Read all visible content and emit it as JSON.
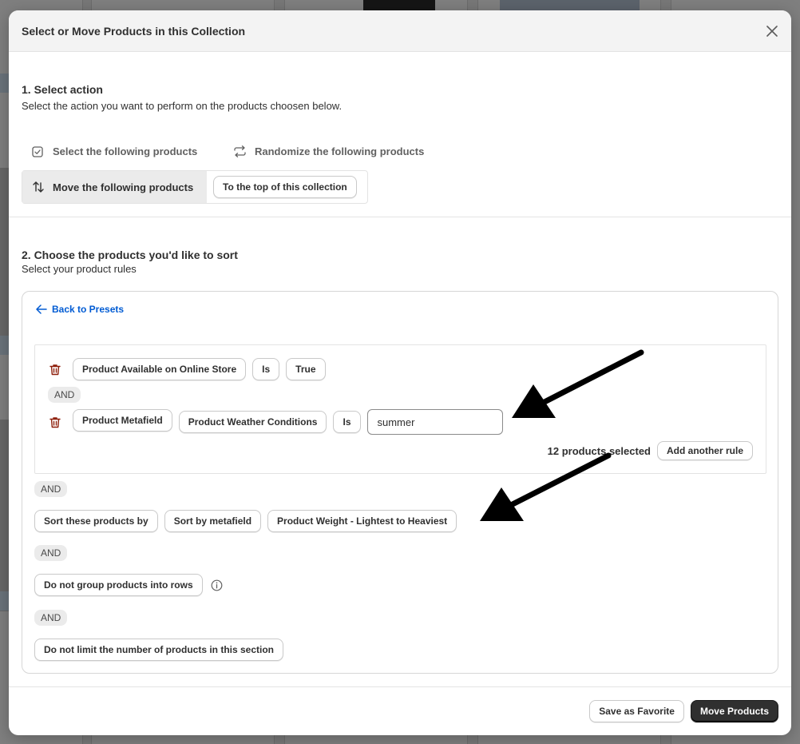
{
  "modal": {
    "title": "Select or Move Products in this Collection",
    "close_icon": "close-icon"
  },
  "step1": {
    "title": "1. Select action",
    "subtitle": "Select the action you want to perform on the products choosen below.",
    "options": {
      "select_label": "Select the following products",
      "randomize_label": "Randomize the following products",
      "move_label": "Move the following products",
      "move_target": "To the top of this collection"
    }
  },
  "step2": {
    "title": "2. Choose the products you'd like to sort",
    "subtitle": "Select your product rules",
    "back_link": "Back to Presets",
    "rules": [
      {
        "field": "Product Available on Online Store",
        "operator": "Is",
        "value": "True"
      },
      {
        "field": "Product Metafield",
        "subfield": "Product Weather Conditions",
        "operator": "Is",
        "value": "summer"
      }
    ],
    "and_label": "AND",
    "selected_count": "12 products selected",
    "add_rule": "Add another rule",
    "sort": {
      "label": "Sort these products by",
      "type": "Sort by metafield",
      "order": "Product Weight - Lightest to Heaviest"
    },
    "group_label": "Do not group products into rows",
    "limit_label": "Do not limit the number of products in this section"
  },
  "footer": {
    "save_favorite": "Save as Favorite",
    "move_products": "Move Products"
  },
  "colors": {
    "primary": "#303030",
    "link": "#005bd3",
    "danger": "#8e1f0b"
  }
}
